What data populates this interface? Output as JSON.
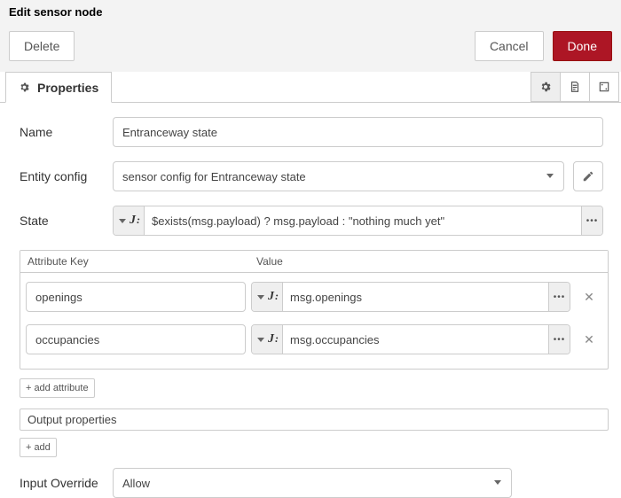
{
  "dialog": {
    "title": "Edit sensor node",
    "buttons": {
      "delete": "Delete",
      "cancel": "Cancel",
      "done": "Done"
    }
  },
  "tabs": {
    "properties": "Properties"
  },
  "form": {
    "name_label": "Name",
    "name_value": "Entranceway state",
    "entity_label": "Entity config",
    "entity_value": "sensor config for Entranceway state",
    "state_label": "State",
    "state_value": "$exists(msg.payload) ? msg.payload : \"nothing much yet\"",
    "input_override_label": "Input Override",
    "input_override_value": "Allow"
  },
  "attributes": {
    "header_key": "Attribute Key",
    "header_value": "Value",
    "rows": [
      {
        "key": "openings",
        "value": "msg.openings"
      },
      {
        "key": "occupancies",
        "value": "msg.occupancies"
      }
    ],
    "add_label": "add attribute"
  },
  "output": {
    "title": "Output properties",
    "add_label": "add"
  }
}
